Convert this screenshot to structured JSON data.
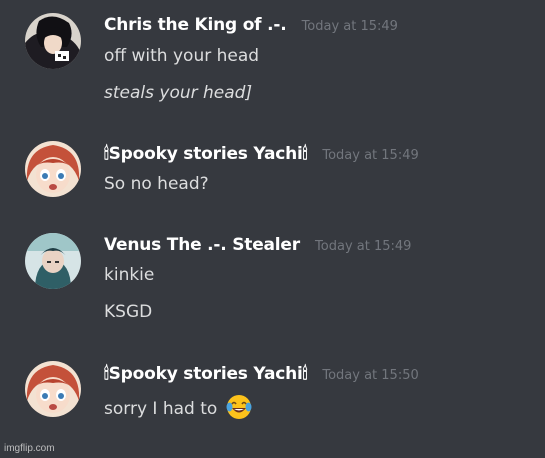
{
  "messages": [
    {
      "username": "Chris the King of .-.",
      "timestamp": "Today at 15:49",
      "avatar_icon": "dark-haired-anime-avatar",
      "lines": [
        "off with your head",
        "steals your head]"
      ]
    },
    {
      "username": "🕯Spooky stories Yachi🕯",
      "timestamp": "Today at 15:49",
      "avatar_icon": "red-haired-anime-avatar",
      "lines": [
        "So no head?"
      ]
    },
    {
      "username": "Venus The .-. Stealer",
      "timestamp": "Today at 15:49",
      "avatar_icon": "teal-anime-avatar",
      "lines": [
        "kinkie",
        "KSGD"
      ]
    },
    {
      "username": "🕯Spooky stories Yachi🕯",
      "timestamp": "Today at 15:50",
      "avatar_icon": "red-haired-anime-avatar",
      "lines": [
        "sorry I had to"
      ],
      "emoji": "joy-emoji"
    }
  ],
  "watermark": "imgflip.com",
  "colors": {
    "background": "#36393f",
    "username": "#ffffff",
    "text": "#dcddde",
    "timestamp": "#72767d"
  }
}
